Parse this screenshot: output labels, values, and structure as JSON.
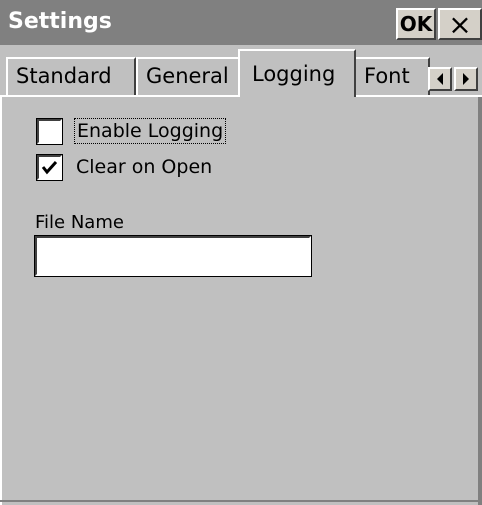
{
  "window": {
    "title": "Settings",
    "ok_label": "OK",
    "close_label": "×"
  },
  "tabs": [
    {
      "label": "Standard",
      "active": false
    },
    {
      "label": "General",
      "active": false
    },
    {
      "label": "Logging",
      "active": true
    },
    {
      "label": "Font",
      "active": false
    }
  ],
  "tab_scroll": {
    "left_icon": "arrow-left-icon",
    "right_icon": "arrow-right-icon"
  },
  "logging": {
    "enable_logging": {
      "label": "Enable Logging",
      "checked": false
    },
    "clear_on_open": {
      "label": "Clear on Open",
      "checked": true
    },
    "file_name": {
      "label": "File Name",
      "value": "",
      "placeholder": ""
    }
  },
  "colors": {
    "titlebar": "#808080",
    "face": "#c0c0c0",
    "title_text": "#ffffff"
  }
}
